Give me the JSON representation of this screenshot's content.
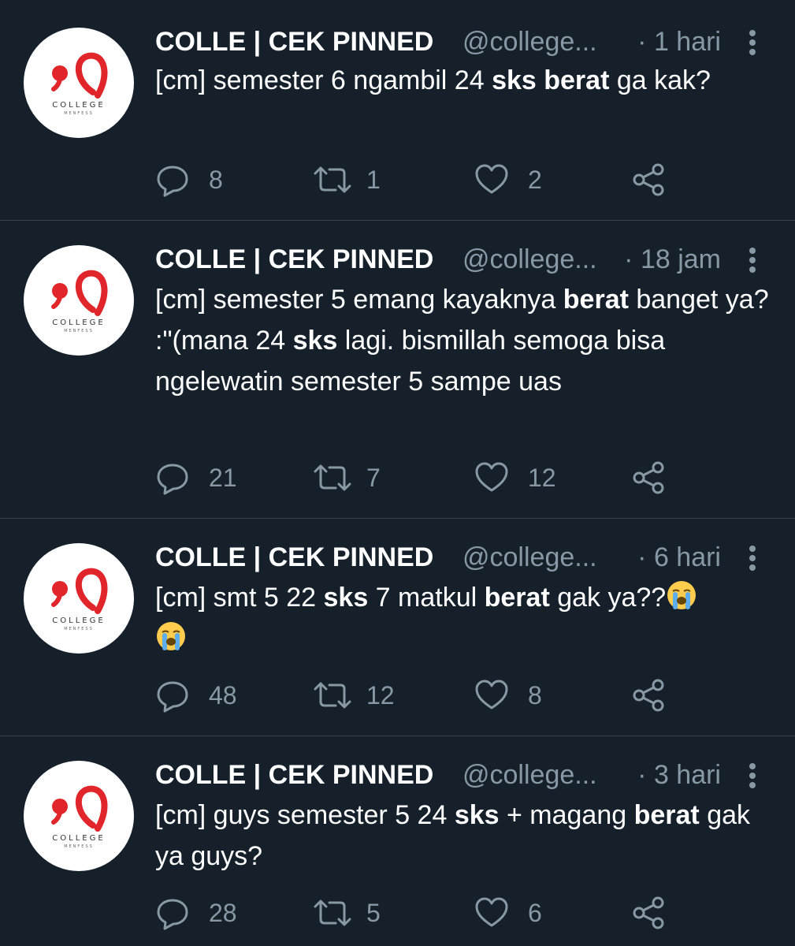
{
  "tweets": [
    {
      "name": "COLLE | CEK PINNED",
      "handle": "@college...",
      "time": "· 1 hari",
      "segments": [
        {
          "text": "[cm] semester 6 ngambil 24 ",
          "bold": false
        },
        {
          "text": "sks",
          "bold": true
        },
        {
          "text": " ",
          "bold": false
        },
        {
          "text": "berat",
          "bold": true
        },
        {
          "text": " ga kak?",
          "bold": false
        }
      ],
      "replies": "8",
      "retweets": "1",
      "likes": "2"
    },
    {
      "name": "COLLE | CEK PINNED",
      "handle": "@college...",
      "time": "· 18 jam",
      "segments": [
        {
          "text": "[cm] semester 5 emang kayaknya ",
          "bold": false
        },
        {
          "text": "berat",
          "bold": true
        },
        {
          "text": " banget ya? :\"(mana 24 ",
          "bold": false
        },
        {
          "text": "sks",
          "bold": true
        },
        {
          "text": " lagi. bismillah semoga bisa ngelewatin semester 5 sampe uas",
          "bold": false
        }
      ],
      "replies": "21",
      "retweets": "7",
      "likes": "12"
    },
    {
      "name": "COLLE | CEK PINNED",
      "handle": "@college...",
      "time": "· 6 hari",
      "segments": [
        {
          "text": "[cm] smt 5 22 ",
          "bold": false
        },
        {
          "text": "sks",
          "bold": true
        },
        {
          "text": " 7 matkul ",
          "bold": false
        },
        {
          "text": "berat",
          "bold": true
        },
        {
          "text": " gak ya??",
          "bold": false
        }
      ],
      "emoji_count": 2,
      "replies": "48",
      "retweets": "12",
      "likes": "8"
    },
    {
      "name": "COLLE | CEK PINNED",
      "handle": "@college...",
      "time": "· 3 hari",
      "segments": [
        {
          "text": "[cm] guys semester 5 24 ",
          "bold": false
        },
        {
          "text": "sks",
          "bold": true
        },
        {
          "text": " + magang ",
          "bold": false
        },
        {
          "text": "berat",
          "bold": true
        },
        {
          "text": " gak ya guys?",
          "bold": false
        }
      ],
      "replies": "28",
      "retweets": "5",
      "likes": "6"
    }
  ],
  "avatar": {
    "brand": "COLLEGE",
    "sub": "MENFESS",
    "brand_color": "#e0262b"
  },
  "icons": {
    "reply": "reply-icon",
    "retweet": "retweet-icon",
    "like": "heart-icon",
    "share": "share-icon",
    "more": "more-options-icon",
    "emoji": "loudly-crying-face-emoji"
  },
  "colors": {
    "background": "#15202b",
    "text": "#ffffff",
    "muted": "#8899a6",
    "divider": "#38444d"
  }
}
